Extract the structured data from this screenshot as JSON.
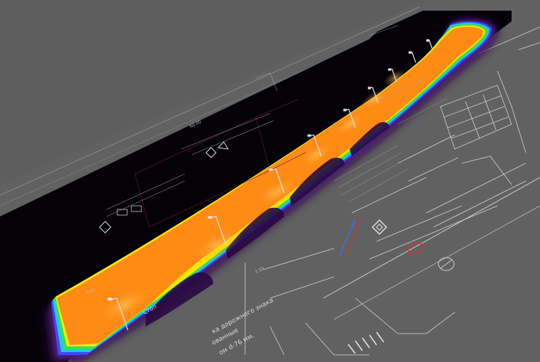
{
  "viewport": {
    "description_free": true
  },
  "drawing_labels": {
    "road_sign_line1": "ка дорожного знака",
    "road_sign_line2": "ованные",
    "road_sign_line3": "ом d-76 мм.",
    "stop_label": "Стоп",
    "elev_label_1": "60.00",
    "elev_label_2": "0.14",
    "elev_label_3": "1.50"
  },
  "colors": {
    "background": "#5e5e5e",
    "ground_black": "#050207",
    "heat_orange": "#ff8a14",
    "heat_yellow": "#ffe600",
    "heat_green": "#33e24a",
    "heat_cyan": "#22c8e8",
    "heat_blue": "#3b4bff",
    "heat_violet": "#7a2dd6",
    "heat_purple": "#3a0d58",
    "cad_lines": "#cfcfcf",
    "red_marker": "#e0302a",
    "blue_marker": "#3c6bff"
  },
  "icons": {
    "pole": "lamp-post-icon",
    "sign": "road-sign-icon",
    "marker": "ellipse-marker-icon"
  }
}
